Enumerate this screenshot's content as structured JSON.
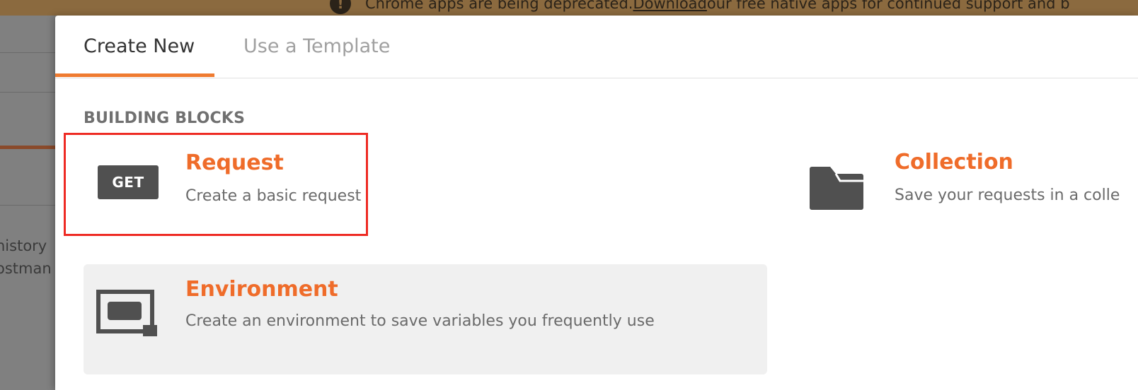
{
  "banner": {
    "icon": "exclamation-icon",
    "text_before": "Chrome apps are being deprecated. ",
    "link": "Download",
    "text_after": " our free native apps for continued support and b"
  },
  "background_app": {
    "text_line1": "history",
    "text_line2": "ostman"
  },
  "tabs": [
    {
      "label": "Create New",
      "active": true
    },
    {
      "label": "Use a Template",
      "active": false
    }
  ],
  "section_title": "BUILDING BLOCKS",
  "blocks": {
    "request": {
      "badge": "GET",
      "title": "Request",
      "description": "Create a basic request"
    },
    "collection": {
      "icon": "folder-icon",
      "title": "Collection",
      "description": "Save your requests in a colle"
    },
    "environment": {
      "icon": "environment-icon",
      "title": "Environment",
      "description": "Create an environment to save variables you frequently use"
    }
  },
  "colors": {
    "accent": "#ef6c2a",
    "highlight_border": "#ee2b24",
    "banner": "#8b6a3f"
  }
}
